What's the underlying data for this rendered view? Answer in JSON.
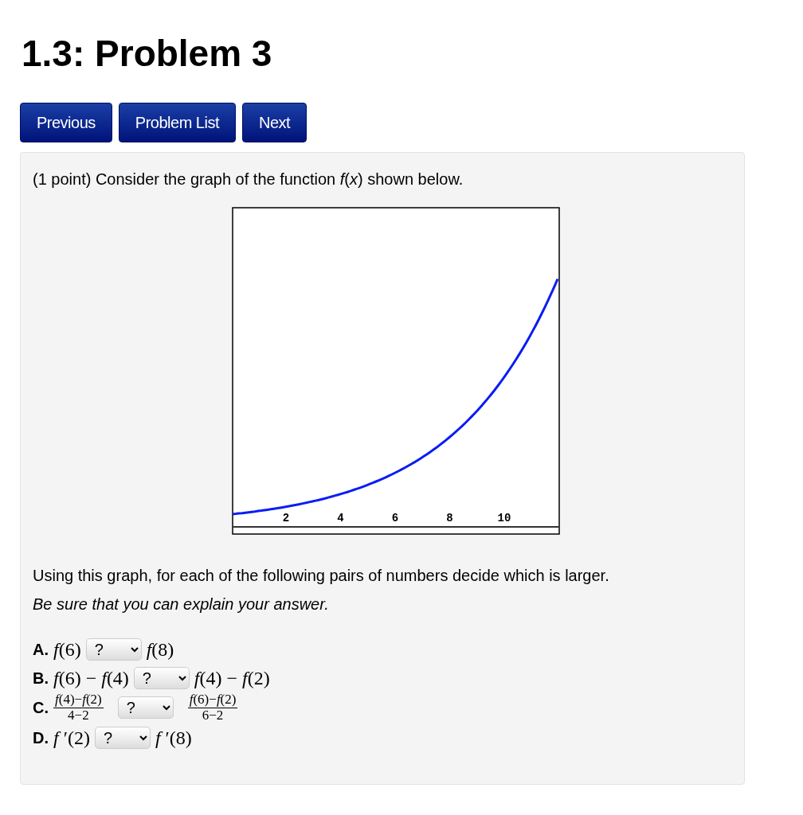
{
  "title": "1.3: Problem 3",
  "nav_buttons": [
    "Previous",
    "Problem List",
    "Next"
  ],
  "problem": {
    "intro": "(1 point) Consider the graph of the function *f*(*x*) shown below.",
    "graph": {
      "x_tick_labels": [
        "2",
        "4",
        "6",
        "8",
        "10"
      ]
    },
    "instruction": "Using this graph, for each of the following pairs of numbers decide which is larger.",
    "note": "Be sure that you can explain your answer.",
    "parts": [
      {
        "label": "A.",
        "kind": "inline",
        "left": "*f*(6)",
        "answer": "?",
        "right": "*f*(8)"
      },
      {
        "label": "B.",
        "kind": "inline",
        "left": "*f*(6) − *f*(4)",
        "answer": "?",
        "right": "*f*(4) − *f*(2)"
      },
      {
        "label": "C.",
        "kind": "fraction",
        "left": {
          "numerator": "*f*(4)−*f*(2)",
          "denominator": "4−2"
        },
        "answer": "?",
        "right": {
          "numerator": "*f*(6)−*f*(2)",
          "denominator": "6−2"
        }
      },
      {
        "label": "D.",
        "kind": "inline",
        "left": "*f* ′(2)",
        "answer": "?",
        "right": "*f* ′(8)"
      }
    ]
  }
}
